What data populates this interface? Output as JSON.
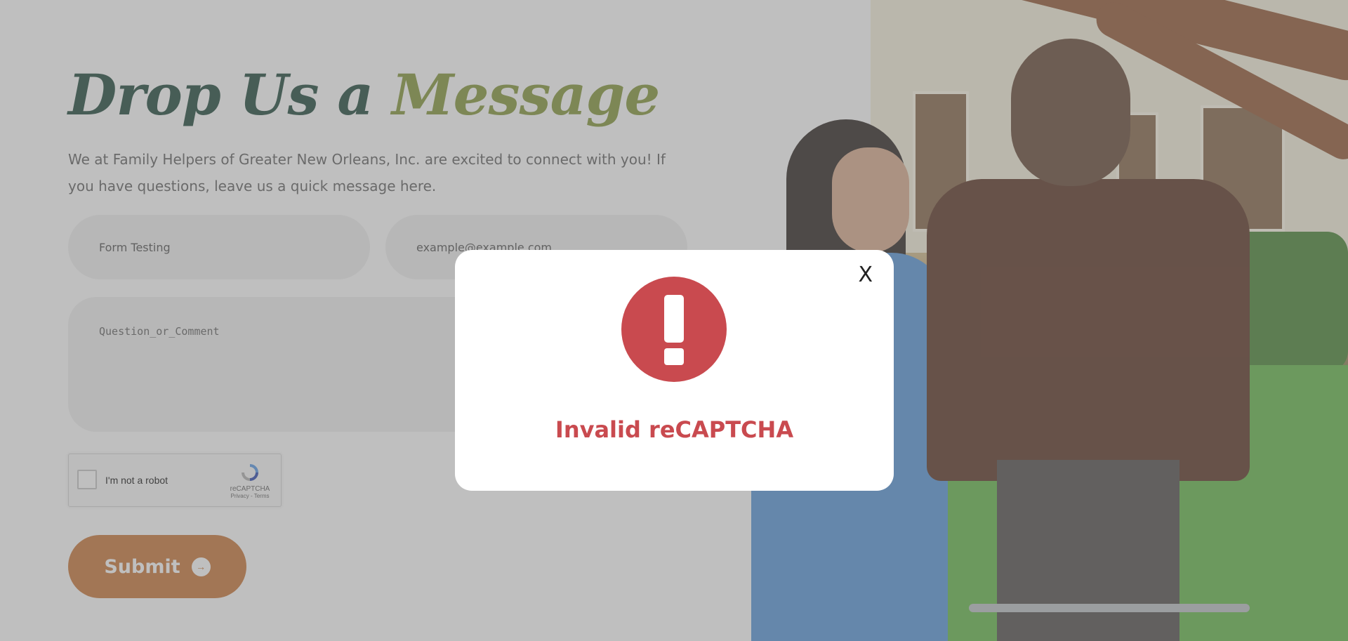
{
  "form": {
    "heading_part1": "Drop Us a",
    "heading_part2": "Message",
    "intro": "We at Family Helpers of Greater New Orleans, Inc. are excited to connect with you! If you have questions, leave us a quick message here.",
    "name_value": "Form Testing",
    "email_value": "example@example.com",
    "comment_placeholder": "Question_or_Comment",
    "submit_label": "Submit",
    "submit_icon": "arrow-right-icon"
  },
  "recaptcha": {
    "label": "I'm not a robot",
    "brand": "reCAPTCHA",
    "links": "Privacy - Terms"
  },
  "modal": {
    "close_label": "X",
    "icon": "exclamation-icon",
    "message": "Invalid reCAPTCHA"
  },
  "colors": {
    "heading_dark": "#0f3a2c",
    "heading_accent": "#7b8e2a",
    "submit_bg": "#c56c2a",
    "error": "#c94a4f"
  }
}
